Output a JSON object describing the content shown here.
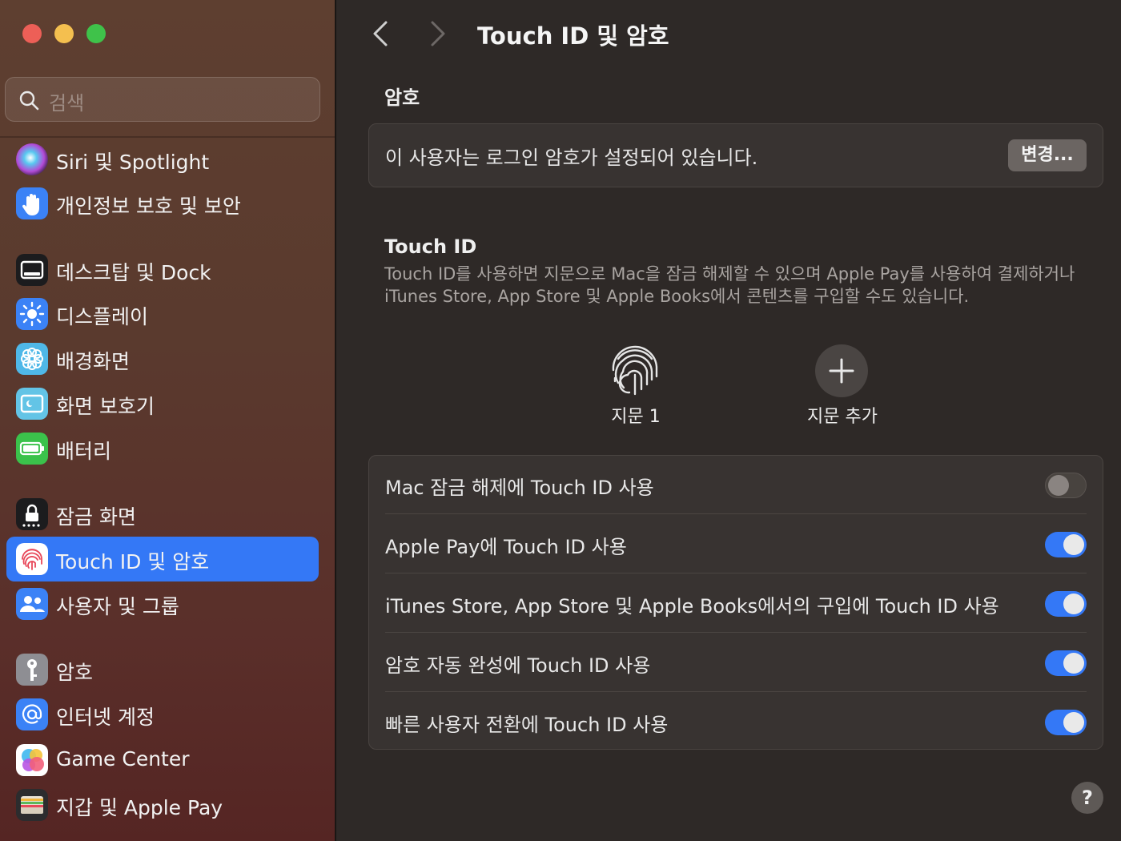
{
  "window": {
    "title": "Touch ID 및 암호"
  },
  "search": {
    "placeholder": "검색",
    "icon": "search-icon"
  },
  "sidebar": {
    "items": [
      {
        "label": "Siri 및 Spotlight",
        "icon": "siri-icon",
        "selected": false
      },
      {
        "label": "개인정보 보호 및 보안",
        "icon": "hand-icon",
        "selected": false
      },
      {
        "label": "데스크탑 및 Dock",
        "icon": "dock-icon",
        "selected": false
      },
      {
        "label": "디스플레이",
        "icon": "sun-icon",
        "selected": false
      },
      {
        "label": "배경화면",
        "icon": "flower-icon",
        "selected": false
      },
      {
        "label": "화면 보호기",
        "icon": "screensaver-icon",
        "selected": false
      },
      {
        "label": "배터리",
        "icon": "battery-icon",
        "selected": false
      },
      {
        "label": "잠금 화면",
        "icon": "lock-icon",
        "selected": false
      },
      {
        "label": "Touch ID 및 암호",
        "icon": "fingerprint-icon",
        "selected": true
      },
      {
        "label": "사용자 및 그룹",
        "icon": "users-icon",
        "selected": false
      },
      {
        "label": "암호",
        "icon": "key-icon",
        "selected": false
      },
      {
        "label": "인터넷 계정",
        "icon": "at-icon",
        "selected": false
      },
      {
        "label": "Game Center",
        "icon": "game-center-icon",
        "selected": false
      },
      {
        "label": "지갑 및 Apple Pay",
        "icon": "wallet-icon",
        "selected": false
      }
    ]
  },
  "password": {
    "section_title": "암호",
    "status_text": "이 사용자는 로그인 암호가 설정되어 있습니다.",
    "change_button": "변경..."
  },
  "touchid": {
    "section_title": "Touch ID",
    "description": "Touch ID를 사용하면 지문으로 Mac을 잠금 해제할 수 있으며 Apple Pay를 사용하여 결제하거나 iTunes Store, App Store 및 Apple Books에서 콘텐츠를 구입할 수도 있습니다.",
    "fingerprint_label": "지문 1",
    "add_label": "지문 추가"
  },
  "options": [
    {
      "label": "Mac 잠금 해제에 Touch ID 사용",
      "enabled": false
    },
    {
      "label": "Apple Pay에 Touch ID 사용",
      "enabled": true
    },
    {
      "label": "iTunes Store, App Store 및 Apple Books에서의 구입에 Touch ID 사용",
      "enabled": true
    },
    {
      "label": "암호 자동 완성에 Touch ID 사용",
      "enabled": true
    },
    {
      "label": "빠른 사용자 전환에 Touch ID 사용",
      "enabled": true
    }
  ],
  "help": {
    "label": "?"
  },
  "colors": {
    "accent": "#3478f6",
    "toggle_off": "#48433f"
  }
}
